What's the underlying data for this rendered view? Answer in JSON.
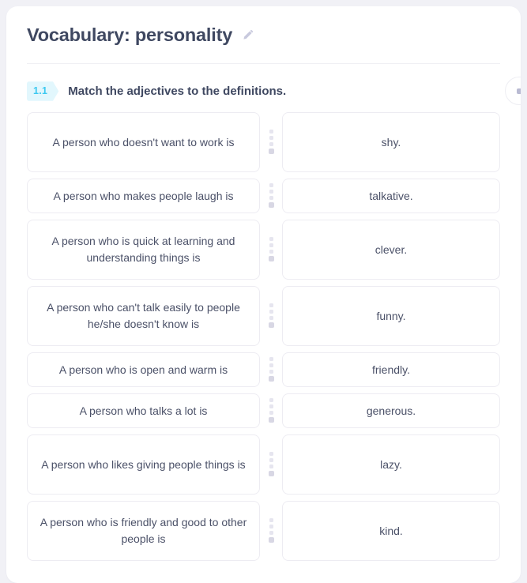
{
  "page": {
    "background_color": "#f1f1f6",
    "card_background": "#ffffff"
  },
  "header": {
    "title": "Vocabulary: personality",
    "edit_icon": "pencil-icon"
  },
  "task": {
    "badge": "1.1",
    "badge_bg_color": "#e2f7fd",
    "badge_text_color": "#3cc9f1",
    "instruction": "Match the adjectives to the definitions.",
    "options_button_icon": "more-options-icon"
  },
  "match_rows": [
    {
      "definition": "A person who doesn't want to work is",
      "adjective": "shy.",
      "lines": 2
    },
    {
      "definition": "A person who makes people laugh is",
      "adjective": "talkative.",
      "lines": 1
    },
    {
      "definition": "A person who is quick at learning and understanding things is",
      "adjective": "clever.",
      "lines": 2
    },
    {
      "definition": "A person who can't talk easily to people he/she doesn't know is",
      "adjective": "funny.",
      "lines": 2
    },
    {
      "definition": "A person who is open and warm is",
      "adjective": "friendly.",
      "lines": 1
    },
    {
      "definition": "A person who talks a lot is",
      "adjective": "generous.",
      "lines": 1
    },
    {
      "definition": "A person who likes giving people things is",
      "adjective": "lazy.",
      "lines": 2
    },
    {
      "definition": "A person who is friendly and good to other people is",
      "adjective": "kind.",
      "lines": 2
    }
  ]
}
